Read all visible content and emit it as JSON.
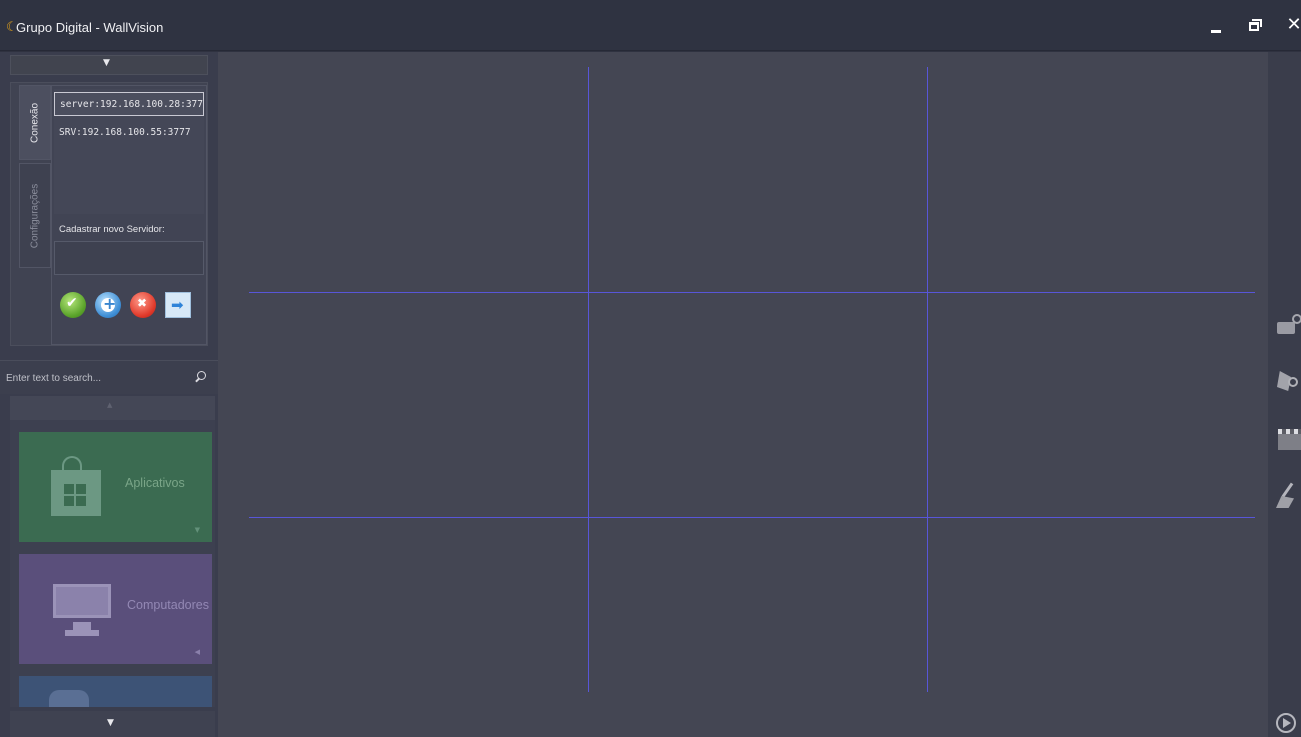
{
  "window": {
    "title": "Grupo Digital - WallVision",
    "logo_glyph": "☾",
    "close_glyph": "✕"
  },
  "left_panel": {
    "collapse_arrow": "▼",
    "tabs": [
      {
        "label": "Conexão",
        "active": true
      },
      {
        "label": "Configurações",
        "active": false
      }
    ],
    "servers": [
      {
        "label": "server:192.168.100.28:3777",
        "selected": true
      },
      {
        "label": "SRV:192.168.100.55:3777",
        "selected": false
      }
    ],
    "new_server_label": "Cadastrar novo Servidor:",
    "new_server_value": "",
    "actions": [
      "confirm-icon",
      "add-icon",
      "delete-icon",
      "connect-arrow-icon"
    ]
  },
  "search": {
    "placeholder": "Enter text to search..."
  },
  "tiles": {
    "up_arrow": "▲",
    "down_arrow": "▼",
    "items": [
      {
        "label": "Aplicativos",
        "color": "#3b6b51",
        "corner": "▼"
      },
      {
        "label": "Computadores",
        "color": "#5a4f7b",
        "corner": "◀"
      }
    ]
  },
  "grid": {
    "columns": 3,
    "rows": 3,
    "line_color": "#5856d8"
  },
  "right_toolbar": {
    "tools": [
      "camera-add-icon",
      "camera-search-icon",
      "clapperboard-icon",
      "clean-brush-icon",
      "play-icon"
    ]
  }
}
